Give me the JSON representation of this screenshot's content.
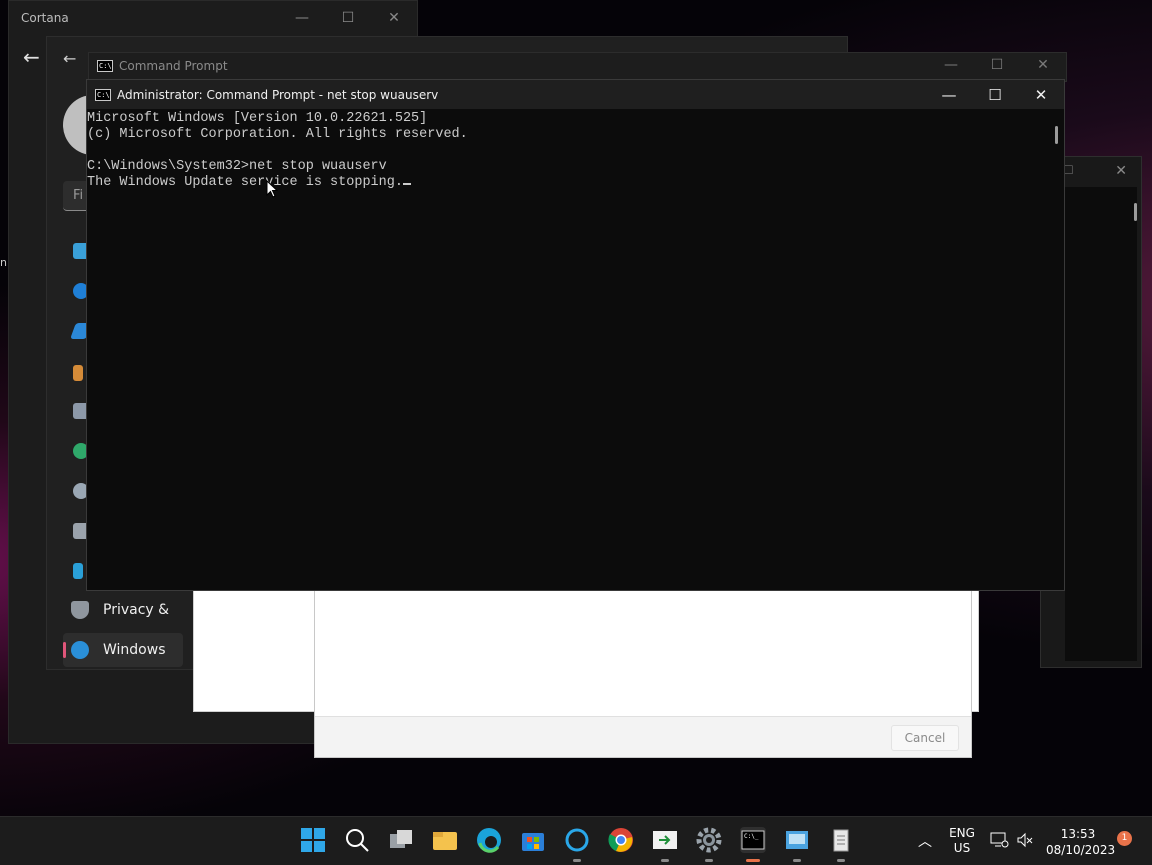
{
  "cortana": {
    "title": "Cortana"
  },
  "settings": {
    "search_placeholder": "Fi",
    "nav": [
      {
        "label": "Privacy &",
        "icon": "shield-icon"
      },
      {
        "label": "Windows",
        "icon": "windows-update-icon"
      }
    ],
    "left_stub": "n"
  },
  "cmd_back": {
    "title": "Command Prompt"
  },
  "cmd": {
    "title": "Administrator: Command Prompt - net  stop wuauserv",
    "lines": [
      "Microsoft Windows [Version 10.0.22621.525]",
      "(c) Microsoft Corporation. All rights reserved.",
      "",
      "C:\\Windows\\System32>net stop wuauserv",
      "The Windows Update service is stopping."
    ]
  },
  "dialog": {
    "cancel_label": "Cancel"
  },
  "taskbar": {
    "lang_top": "ENG",
    "lang_bottom": "US",
    "time": "13:53",
    "date": "08/10/2023",
    "notification_count": "1"
  }
}
